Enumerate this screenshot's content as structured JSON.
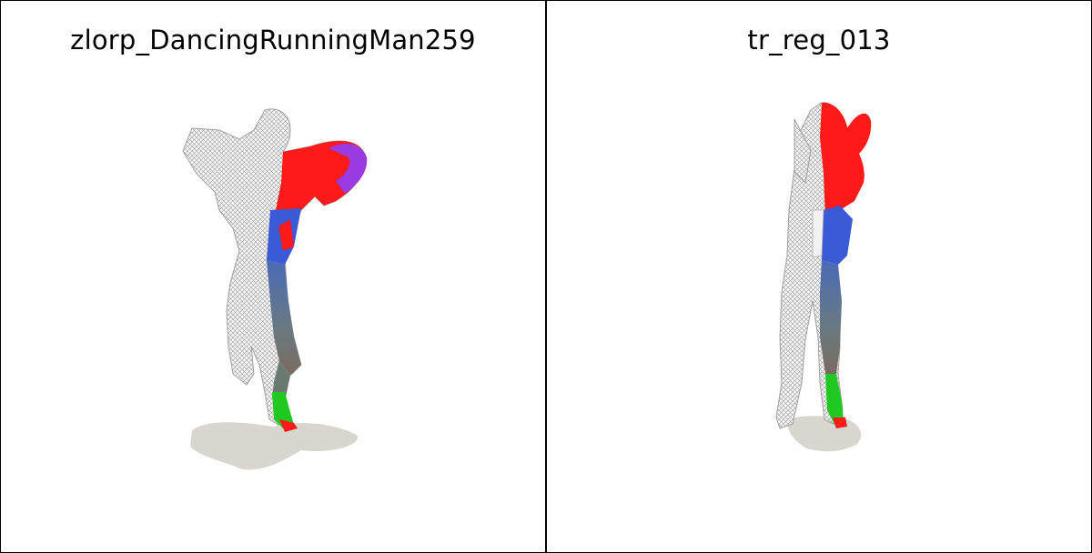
{
  "panels": [
    {
      "title": "zlorp_DancingRunningMan259"
    },
    {
      "title": "tr_reg_013"
    }
  ],
  "colors": {
    "background": "#ffffff",
    "border": "#000000",
    "wireframe": "#b8b8b8",
    "shadow": "#d8d6cf",
    "segment_red": "#ff1a1a",
    "segment_blue": "#3a5ad8",
    "segment_green": "#22c822",
    "segment_purple": "#9a3ae0",
    "segment_slate": "#4f6fa0"
  }
}
